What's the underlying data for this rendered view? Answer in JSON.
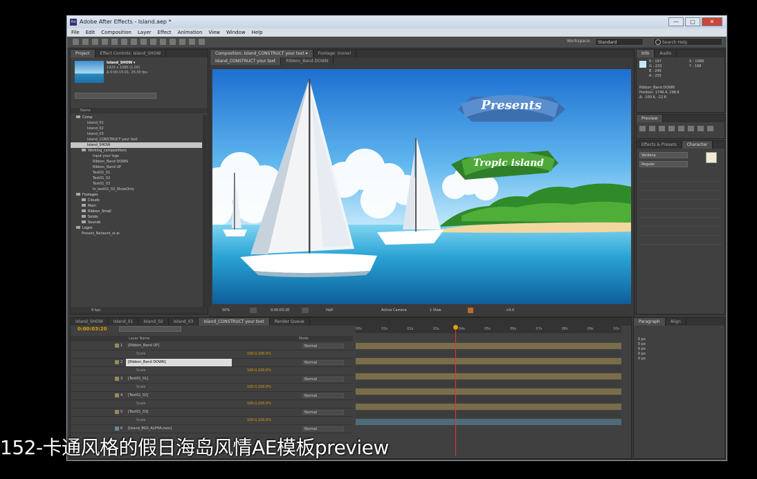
{
  "window": {
    "title": "Adobe After Effects - Island.aep *",
    "min_label": "—",
    "max_label": "□",
    "close_label": "✕"
  },
  "menu": [
    "File",
    "Edit",
    "Composition",
    "Layer",
    "Effect",
    "Animation",
    "View",
    "Window",
    "Help"
  ],
  "toolbar": {
    "workspace_label": "Workspace:",
    "workspace_value": "Standard",
    "search_placeholder": "Search Help"
  },
  "project": {
    "tabs": [
      "Project",
      "Effect Controls: Island_SHOW"
    ],
    "item_name": "Island_SHOW ▾",
    "item_info": [
      "1920 x 1080 (1.00)",
      "Δ 0:00:15:01, 25.00 fps"
    ],
    "column_name": "Name",
    "tree": [
      {
        "label": "Comp",
        "type": "folder",
        "indent": 0
      },
      {
        "label": "Island_01",
        "type": "comp",
        "indent": 2
      },
      {
        "label": "Island_02",
        "type": "comp",
        "indent": 2
      },
      {
        "label": "Island_03",
        "type": "comp",
        "indent": 2
      },
      {
        "label": "Island_CONSTRUCT your text",
        "type": "comp",
        "indent": 2
      },
      {
        "label": "Island_SHOW",
        "type": "comp",
        "indent": 2,
        "selected": true
      },
      {
        "label": "Working_compositions",
        "type": "folder",
        "indent": 1
      },
      {
        "label": "Input your logo",
        "type": "comp",
        "indent": 3
      },
      {
        "label": "Ribbon_Band DOWN",
        "type": "comp",
        "indent": 3
      },
      {
        "label": "Ribbon_Band UP",
        "type": "comp",
        "indent": 3
      },
      {
        "label": "Text01_01",
        "type": "comp",
        "indent": 3
      },
      {
        "label": "Text01_02",
        "type": "comp",
        "indent": 3
      },
      {
        "label": "Text01_03",
        "type": "comp",
        "indent": 3
      },
      {
        "label": "In_text01_02_ShowOnly",
        "type": "comp",
        "indent": 3
      },
      {
        "label": "Footages",
        "type": "folder",
        "indent": 0
      },
      {
        "label": "Clouds",
        "type": "folder",
        "indent": 1
      },
      {
        "label": "Main",
        "type": "folder",
        "indent": 1
      },
      {
        "label": "Ribbon_Small",
        "type": "folder",
        "indent": 1
      },
      {
        "label": "Solids",
        "type": "folder",
        "indent": 1
      },
      {
        "label": "Sounds",
        "type": "folder",
        "indent": 1
      },
      {
        "label": "Logos",
        "type": "folder",
        "indent": 0
      },
      {
        "label": "Presets_Network_st.ai",
        "type": "comp",
        "indent": 1
      }
    ],
    "bpc": "8 bpc"
  },
  "composition": {
    "tabs": [
      "Composition: Island_CONSTRUCT your text ▾",
      "Footage: (none)"
    ],
    "subtabs": [
      "Island_CONSTRUCT your text",
      "Ribbon_Band DOWN"
    ],
    "ribbon_top_text": "Presents",
    "ribbon_bottom_text": "Tropic island",
    "zoom": "50%",
    "timecode": "0:00:03:20",
    "resolution": "Half",
    "camera": "Active Camera",
    "views": "1 View",
    "offset": "+0.0"
  },
  "right_panel": {
    "info_tabs": [
      "Info",
      "Audio"
    ],
    "info_lines": [
      "R : 197",
      "G : 233",
      "B : 245",
      "A : 255"
    ],
    "info_xy": [
      "X : 1068",
      "Y : 168"
    ],
    "info_layer": [
      "Ribbon_Band DOWN",
      "Position: 1749.4, 298.6",
      "Δ: -100.6, -22.6"
    ],
    "preview_tab": "Preview",
    "char_tabs": [
      "Effects & Presets",
      "Character"
    ],
    "font": "Verdana",
    "style": "Regular",
    "para_tabs": [
      "Paragraph",
      "Align"
    ],
    "para_vals": [
      "0 px",
      "0 px",
      "0 px",
      "0 px",
      "0 px"
    ]
  },
  "timeline": {
    "tabs": [
      "Island_SHOW",
      "Island_01",
      "Island_02",
      "Island_03",
      "Island_CONSTRUCT your text",
      "Render Queue"
    ],
    "timecode": "0:00:03:20",
    "col_header": "Layer Name",
    "mode_header": "Mode",
    "layers": [
      {
        "num": "1",
        "name": "[Ribbon_Band UP]",
        "color": "#9a8a5a",
        "mode": "Normal",
        "sub": false
      },
      {
        "num": "",
        "name": "Scale",
        "value": "100.0,100.0%",
        "sub": true
      },
      {
        "num": "2",
        "name": "[Ribbon_Band DOWN]",
        "color": "#9a8a5a",
        "mode": "Normal",
        "sub": false,
        "selected": true
      },
      {
        "num": "",
        "name": "Scale",
        "value": "100.0,100.0%",
        "sub": true
      },
      {
        "num": "3",
        "name": "[Text01_01]",
        "color": "#9a8a5a",
        "mode": "Normal",
        "sub": false
      },
      {
        "num": "",
        "name": "Scale",
        "value": "100.0,100.0%",
        "sub": true
      },
      {
        "num": "4",
        "name": "[Text01_02]",
        "color": "#9a8a5a",
        "mode": "Normal",
        "sub": false
      },
      {
        "num": "",
        "name": "Scale",
        "value": "100.0,100.0%",
        "sub": true
      },
      {
        "num": "5",
        "name": "[Text01_03]",
        "color": "#9a8a5a",
        "mode": "Normal",
        "sub": false
      },
      {
        "num": "",
        "name": "Scale",
        "value": "100.0,100.0%",
        "sub": true
      },
      {
        "num": "6",
        "name": "[Island_BG0_ALPHA.mov]",
        "color": "#6a8a9a",
        "mode": "Normal",
        "sub": false
      }
    ],
    "ruler": [
      "00s",
      "01s",
      "02s",
      "03s",
      "04s",
      "05s",
      "06s",
      "07s",
      "08s",
      "09s",
      "10s"
    ],
    "playhead_sec": 3.8,
    "duration_sec": 10
  },
  "subtitle": "152-卡通风格的假日海岛风情AE模板preview",
  "colors": {
    "accent": "#e0a000",
    "playhead": "#e03a2a",
    "selection": "#c7c7c7"
  }
}
